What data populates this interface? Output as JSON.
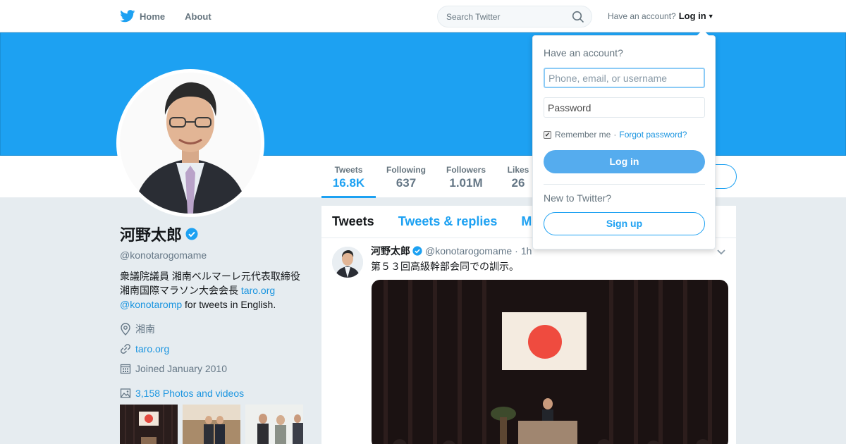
{
  "nav": {
    "home": "Home",
    "about": "About"
  },
  "search": {
    "placeholder": "Search Twitter"
  },
  "account": {
    "prompt": "Have an account?",
    "login": "Log in"
  },
  "profile": {
    "name": "河野太郎",
    "handle": "@konotarogomame",
    "bio_line1": "衆議院議員 湘南ベルマーレ元代表取締役",
    "bio_line2": "湘南国際マラソン大会会長",
    "bio_link": "taro.org",
    "bio_mention": "@konotaromp",
    "bio_tail": " for tweets in English.",
    "location": "湘南",
    "website": "taro.org",
    "joined": "Joined January 2010",
    "photos": "3,158 Photos and videos"
  },
  "stats": [
    {
      "label": "Tweets",
      "value": "16.8K"
    },
    {
      "label": "Following",
      "value": "637"
    },
    {
      "label": "Followers",
      "value": "1.01M"
    },
    {
      "label": "Likes",
      "value": "26"
    }
  ],
  "timeline": {
    "tabs": [
      "Tweets",
      "Tweets & replies",
      "M"
    ],
    "tweet": {
      "name": "河野太郎",
      "handle": "@konotarogomame",
      "sep": "·",
      "time": "1h",
      "text": "第５３回高級幹部会同での訓示。"
    }
  },
  "dropdown": {
    "title": "Have an account?",
    "username_placeholder": "Phone, email, or username",
    "password_placeholder": "Password",
    "remember": "Remember me",
    "sep": "·",
    "forgot": "Forgot password?",
    "login_button": "Log in",
    "new_prompt": "New to Twitter?",
    "signup_button": "Sign up"
  },
  "colors": {
    "brand": "#1da1f2",
    "link": "#1b95e0",
    "verified": "#1da1f2",
    "login_button": "#55acee"
  },
  "icons": [
    "twitter-bird-icon",
    "home-icon",
    "search-icon",
    "verified-icon",
    "location-icon",
    "link-icon",
    "calendar-icon",
    "photo-icon",
    "chevron-down-icon"
  ]
}
